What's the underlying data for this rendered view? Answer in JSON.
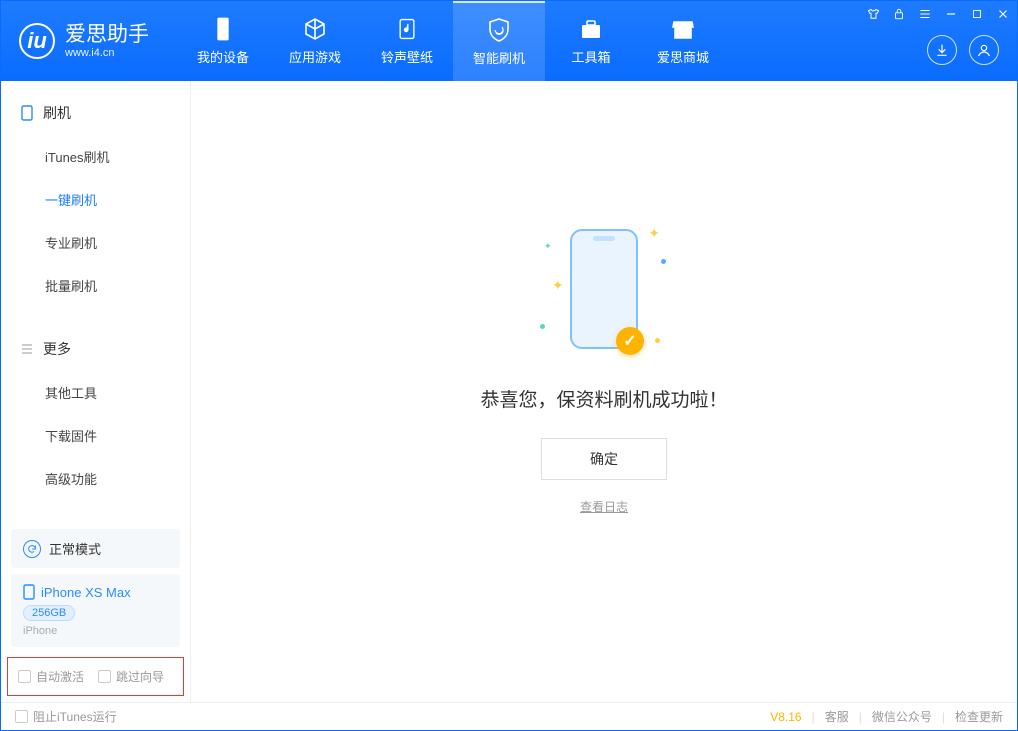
{
  "brand": {
    "name": "爱思助手",
    "url": "www.i4.cn"
  },
  "nav": [
    {
      "label": "我的设备"
    },
    {
      "label": "应用游戏"
    },
    {
      "label": "铃声壁纸"
    },
    {
      "label": "智能刷机"
    },
    {
      "label": "工具箱"
    },
    {
      "label": "爱思商城"
    }
  ],
  "sidebar": {
    "section1": {
      "title": "刷机",
      "items": [
        {
          "label": "iTunes刷机"
        },
        {
          "label": "一键刷机"
        },
        {
          "label": "专业刷机"
        },
        {
          "label": "批量刷机"
        }
      ]
    },
    "section2": {
      "title": "更多",
      "items": [
        {
          "label": "其他工具"
        },
        {
          "label": "下载固件"
        },
        {
          "label": "高级功能"
        }
      ]
    },
    "mode": "正常模式",
    "device": {
      "name": "iPhone XS Max",
      "capacity": "256GB",
      "type": "iPhone"
    },
    "options": {
      "auto_activate": "自动激活",
      "skip_guide": "跳过向导"
    }
  },
  "main": {
    "success_msg": "恭喜您，保资料刷机成功啦！",
    "ok": "确定",
    "view_log": "查看日志"
  },
  "status": {
    "block_itunes": "阻止iTunes运行",
    "version": "V8.16",
    "support": "客服",
    "wechat": "微信公众号",
    "check_update": "检查更新"
  }
}
